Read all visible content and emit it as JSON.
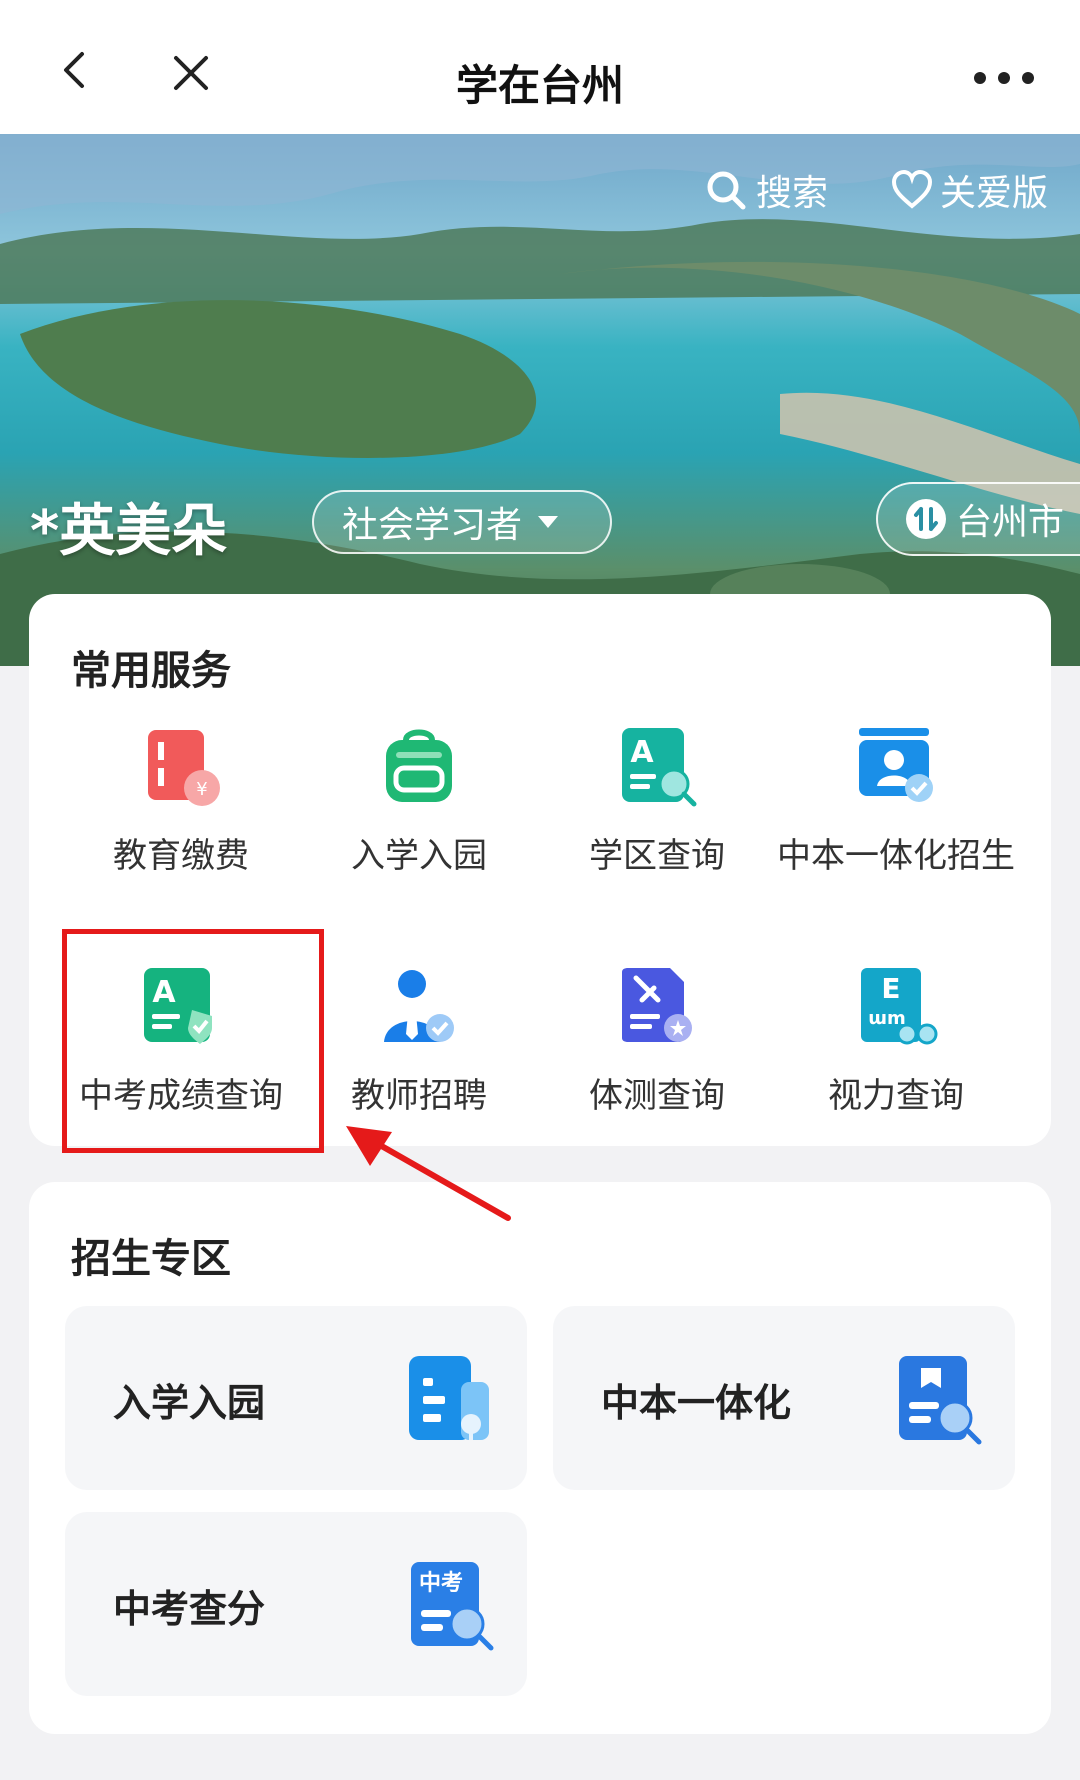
{
  "header": {
    "title": "学在台州"
  },
  "hero": {
    "search_label": "搜索",
    "care_label": "关爱版",
    "username": "*英美朵",
    "role": "社会学习者",
    "city": "台州市"
  },
  "common_services": {
    "title": "常用服务",
    "items": [
      {
        "label": "教育缴费",
        "icon": "education-payment-icon"
      },
      {
        "label": "入学入园",
        "icon": "school-bag-icon"
      },
      {
        "label": "学区查询",
        "icon": "district-search-icon"
      },
      {
        "label": "中本一体化招生",
        "icon": "enrollment-icon"
      },
      {
        "label": "中考成绩查询",
        "icon": "exam-score-icon"
      },
      {
        "label": "教师招聘",
        "icon": "teacher-recruit-icon"
      },
      {
        "label": "体测查询",
        "icon": "fitness-test-icon"
      },
      {
        "label": "视力查询",
        "icon": "vision-check-icon"
      }
    ]
  },
  "enrollment_zone": {
    "title": "招生专区",
    "tiles": [
      {
        "label": "入学入园",
        "icon": "enrollment-doc-icon"
      },
      {
        "label": "中本一体化",
        "icon": "book-search-icon"
      },
      {
        "label": "中考查分",
        "icon": "exam-search-icon",
        "icon_text": "中考"
      }
    ]
  },
  "highlight": {
    "color": "#e51a1a"
  }
}
